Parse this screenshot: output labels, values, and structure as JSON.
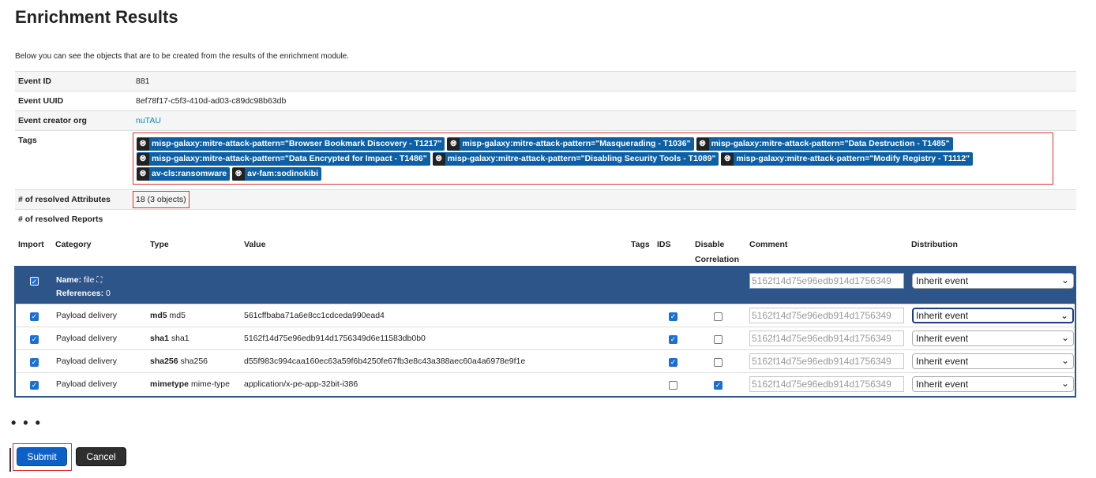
{
  "page": {
    "title": "Enrichment Results",
    "intro": "Below you can see the objects that are to be created from the results of the enrichment module."
  },
  "event": {
    "id_label": "Event ID",
    "id": "881",
    "uuid_label": "Event UUID",
    "uuid": "8ef78f17-c5f3-410d-ad03-c89dc98b63db",
    "org_label": "Event creator org",
    "org": "nuTAU",
    "tags_label": "Tags",
    "tags": [
      "misp-galaxy:mitre-attack-pattern=\"Browser Bookmark Discovery - T1217\"",
      "misp-galaxy:mitre-attack-pattern=\"Masquerading - T1036\"",
      "misp-galaxy:mitre-attack-pattern=\"Data Destruction - T1485\"",
      "misp-galaxy:mitre-attack-pattern=\"Data Encrypted for Impact - T1486\"",
      "misp-galaxy:mitre-attack-pattern=\"Disabling Security Tools - T1089\"",
      "misp-galaxy:mitre-attack-pattern=\"Modify Registry - T1112\"",
      "av-cls:ransomware",
      "av-fam:sodinokibi"
    ],
    "resolved_attributes_label": "# of resolved Attributes",
    "resolved_attributes": "18 (3 objects)",
    "resolved_reports_label": "# of resolved Reports"
  },
  "table": {
    "headers": {
      "import": "Import",
      "category": "Category",
      "type": "Type",
      "value": "Value",
      "tags": "Tags",
      "ids": "IDS",
      "disable_corr_1": "Disable",
      "disable_corr_2": "Correlation",
      "comment": "Comment",
      "distribution": "Distribution"
    },
    "object": {
      "name_label": "Name:",
      "name": "file",
      "references_label": "References:",
      "references": "0",
      "comment": "5162f14d75e96edb914d1756349",
      "distribution": "Inherit event"
    },
    "rows": [
      {
        "category": "Payload delivery",
        "type_bold": "md5",
        "type_rel": "md5",
        "value": "561cffbaba71a6e8cc1cdceda990ead4",
        "ids": true,
        "disable_corr": false,
        "comment": "5162f14d75e96edb914d1756349",
        "distribution": "Inherit event"
      },
      {
        "category": "Payload delivery",
        "type_bold": "sha1",
        "type_rel": "sha1",
        "value": "5162f14d75e96edb914d1756349d6e11583db0b0",
        "ids": true,
        "disable_corr": false,
        "comment": "5162f14d75e96edb914d1756349",
        "distribution": "Inherit event"
      },
      {
        "category": "Payload delivery",
        "type_bold": "sha256",
        "type_rel": "sha256",
        "value": "d55f983c994caa160ec63a59f6b4250fe67fb3e8c43a388aec60a4a6978e9f1e",
        "ids": true,
        "disable_corr": false,
        "comment": "5162f14d75e96edb914d1756349",
        "distribution": "Inherit event"
      },
      {
        "category": "Payload delivery",
        "type_bold": "mimetype",
        "type_rel": "mime-type",
        "value": "application/x-pe-app-32bit-i386",
        "ids": false,
        "disable_corr": true,
        "comment": "5162f14d75e96edb914d1756349",
        "distribution": "Inherit event"
      }
    ]
  },
  "ellipsis": "• • •",
  "buttons": {
    "submit": "Submit",
    "cancel": "Cancel"
  },
  "icons": {
    "tag_icon": "globe-icon",
    "select_icon": "chevron-down-icon",
    "expand_icon": "expand-icon"
  }
}
